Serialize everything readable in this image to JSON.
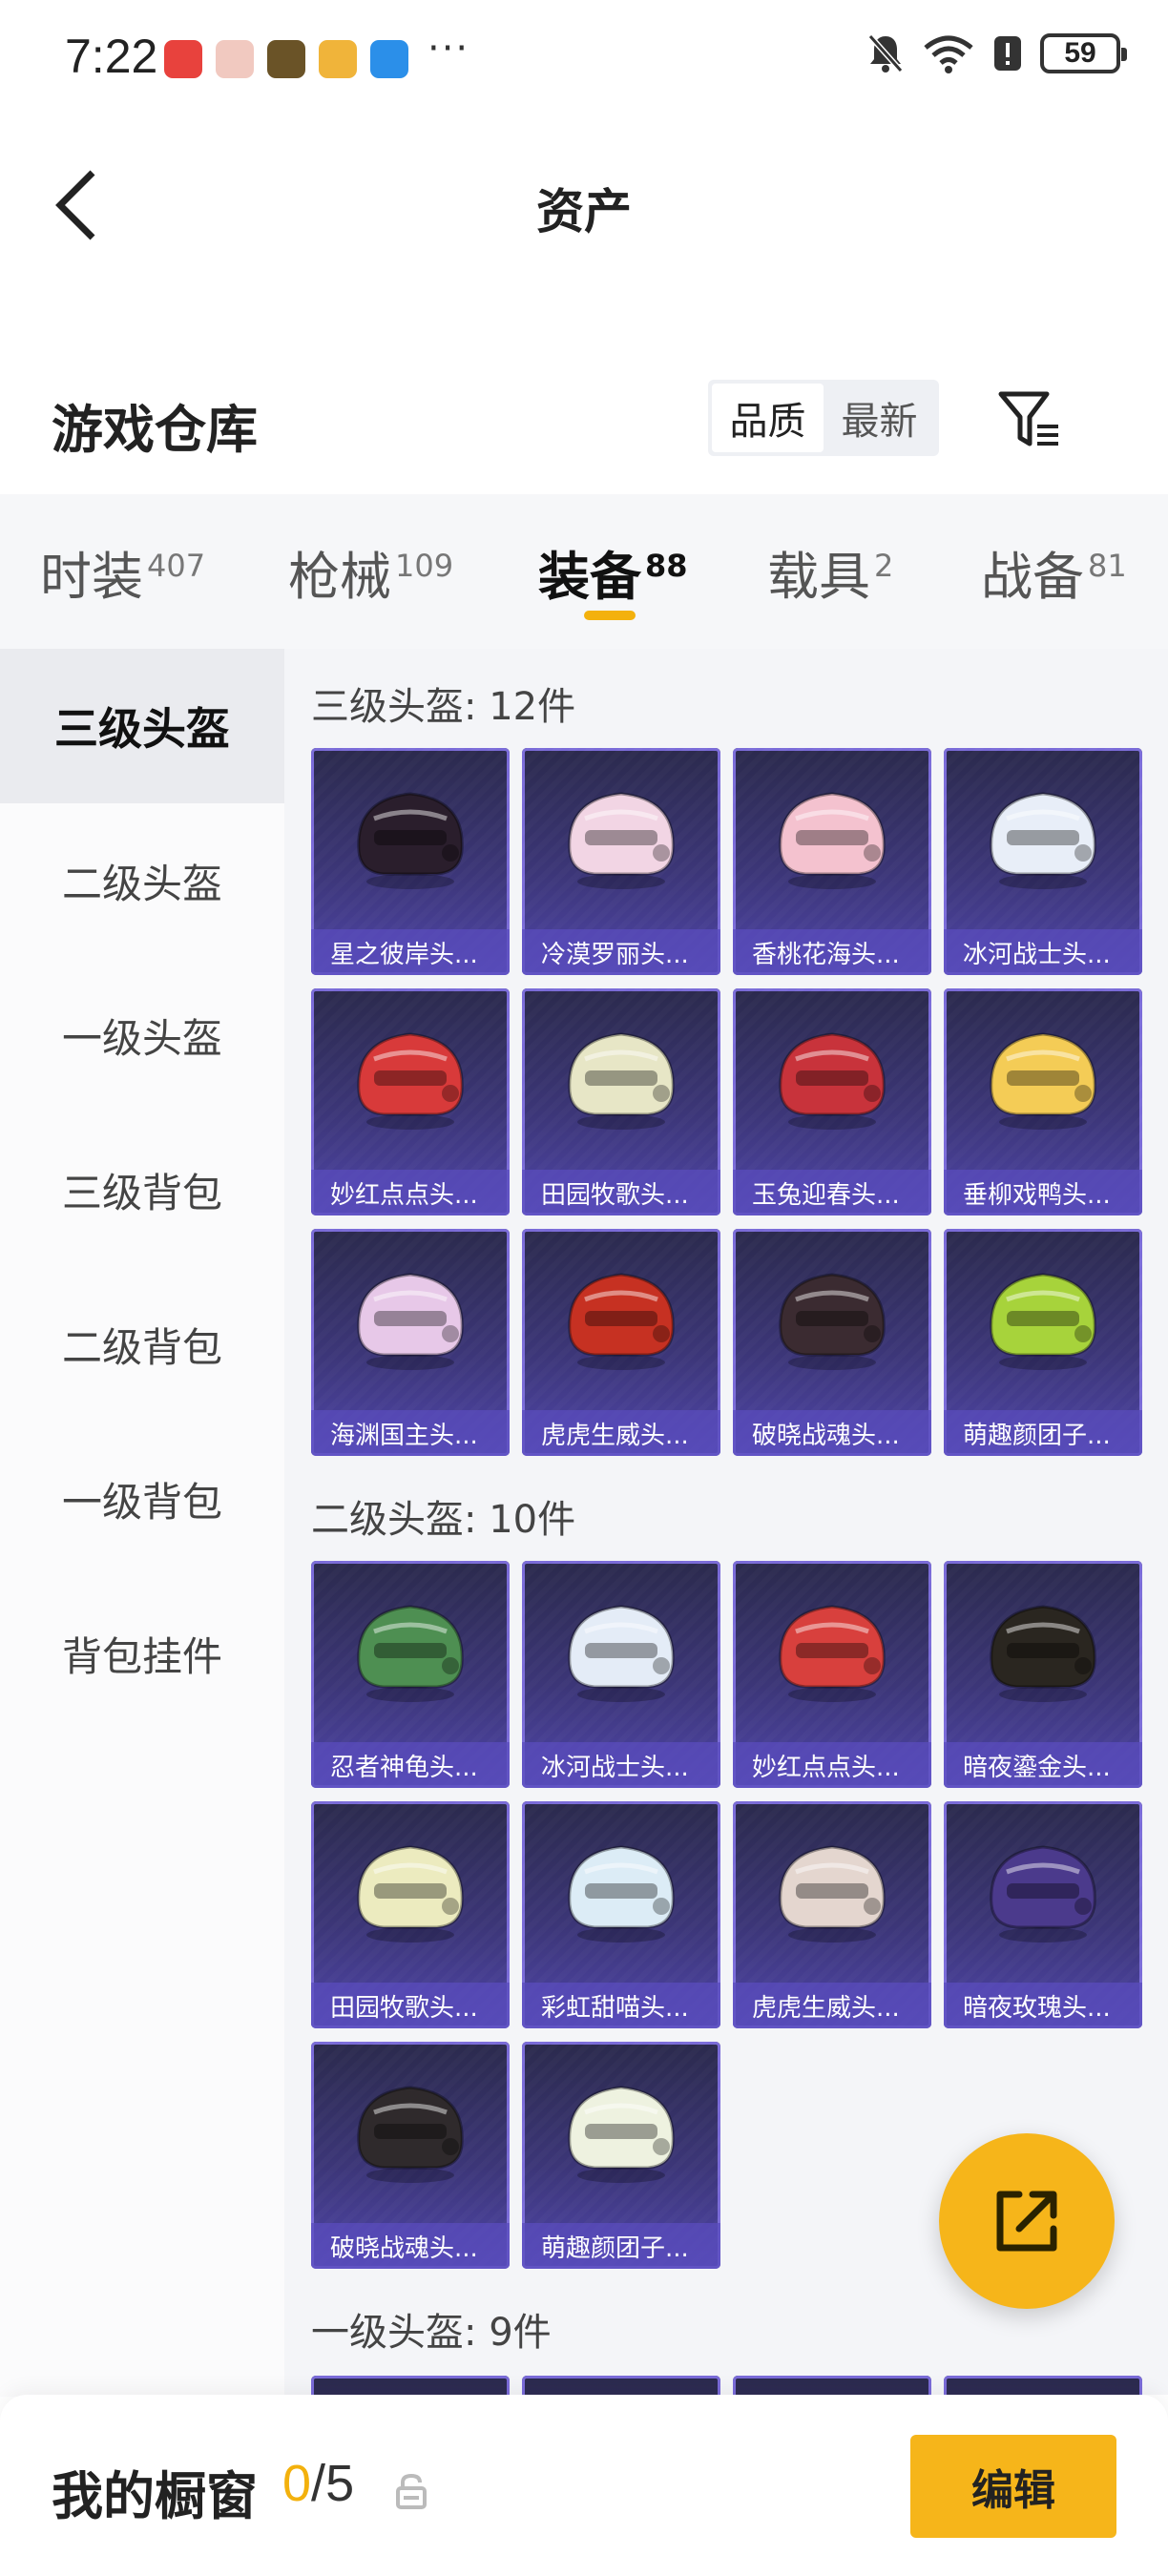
{
  "status_bar": {
    "time": "7:22",
    "battery": "59",
    "overflow": "···"
  },
  "header": {
    "title": "资产"
  },
  "warehouse": {
    "title": "游戏仓库",
    "sort_options": [
      "品质",
      "最新"
    ],
    "active_sort": "品质"
  },
  "tabs": [
    {
      "label": "时装",
      "count": "407"
    },
    {
      "label": "枪械",
      "count": "109"
    },
    {
      "label": "装备",
      "count": "88"
    },
    {
      "label": "载具",
      "count": "2"
    },
    {
      "label": "战备",
      "count": "81"
    }
  ],
  "active_tab": "装备",
  "sidebar": {
    "items": [
      "三级头盔",
      "二级头盔",
      "一级头盔",
      "三级背包",
      "二级背包",
      "一级背包",
      "背包挂件"
    ],
    "active": "三级头盔"
  },
  "sections": [
    {
      "title": "三级头盔: 12件",
      "items": [
        {
          "label": "星之彼岸头...",
          "color": "#2a1e2c"
        },
        {
          "label": "冷漠罗丽头...",
          "color": "#f2d5e4"
        },
        {
          "label": "香桃花海头...",
          "color": "#f4c2cf"
        },
        {
          "label": "冰河战士头...",
          "color": "#e8eef8"
        },
        {
          "label": "妙红点点头...",
          "color": "#d83a3a"
        },
        {
          "label": "田园牧歌头...",
          "color": "#e7e6c6"
        },
        {
          "label": "玉兔迎春头...",
          "color": "#c8333b"
        },
        {
          "label": "垂柳戏鸭头...",
          "color": "#f4cc56"
        },
        {
          "label": "海渊国主头...",
          "color": "#e7c8e8"
        },
        {
          "label": "虎虎生威头...",
          "color": "#c63122"
        },
        {
          "label": "破晓战魂头...",
          "color": "#3b2b31"
        },
        {
          "label": "萌趣颜团子...",
          "color": "#a7d33b"
        }
      ]
    },
    {
      "title": "二级头盔: 10件",
      "items": [
        {
          "label": "忍者神龟头...",
          "color": "#4e8f52"
        },
        {
          "label": "冰河战士头...",
          "color": "#e4ecf7"
        },
        {
          "label": "妙红点点头...",
          "color": "#d8403d"
        },
        {
          "label": "暗夜鎏金头...",
          "color": "#2a2620"
        },
        {
          "label": "田园牧歌头...",
          "color": "#ecebbf"
        },
        {
          "label": "彩虹甜喵头...",
          "color": "#dcecf6"
        },
        {
          "label": "虎虎生威头...",
          "color": "#e4d6cf"
        },
        {
          "label": "暗夜玫瑰头...",
          "color": "#4b3a8c"
        },
        {
          "label": "破晓战魂头...",
          "color": "#2f2a2c"
        },
        {
          "label": "萌趣颜团子...",
          "color": "#eef2e0"
        }
      ]
    },
    {
      "title": "一级头盔: 9件",
      "items": []
    }
  ],
  "bottom_bar": {
    "title": "我的橱窗",
    "current": "0",
    "separator": "/",
    "total": "5",
    "edit_label": "编辑"
  },
  "colors": {
    "accent": "#f3b10d",
    "card_bg": "#3c3678",
    "card_border": "#7a6bd8"
  }
}
